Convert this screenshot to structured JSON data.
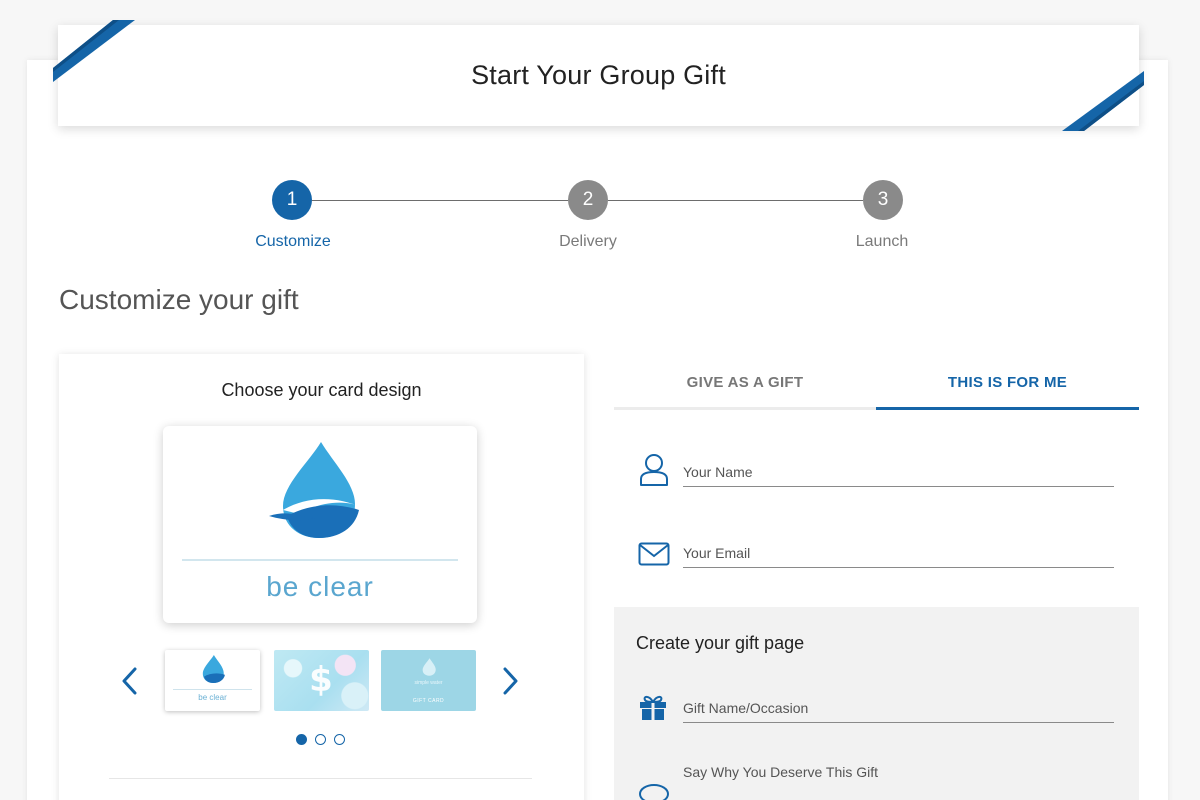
{
  "header": {
    "title": "Start Your Group Gift"
  },
  "steps": [
    {
      "number": "1",
      "label": "Customize",
      "state": "active"
    },
    {
      "number": "2",
      "label": "Delivery",
      "state": "inactive"
    },
    {
      "number": "3",
      "label": "Launch",
      "state": "inactive"
    }
  ],
  "section": {
    "title": "Customize your gift"
  },
  "card_design": {
    "heading": "Choose your card design",
    "preview_tagline": "be clear",
    "thumbnails": [
      {
        "name": "be-clear",
        "text": "be clear"
      },
      {
        "name": "dollar-bubbles",
        "text": "$"
      },
      {
        "name": "gift-card",
        "small_text": "simple water",
        "label": "GIFT CARD"
      }
    ],
    "pagination": {
      "pages": 3,
      "current": 1
    }
  },
  "tabs": [
    {
      "label": "GIVE AS A GIFT",
      "selected": false
    },
    {
      "label": "THIS IS FOR ME",
      "selected": true
    }
  ],
  "form": {
    "name_placeholder": "Your Name",
    "email_placeholder": "Your Email"
  },
  "gift_page": {
    "title": "Create your gift page",
    "occasion_placeholder": "Gift Name/Occasion",
    "reason_placeholder": "Say Why You Deserve This Gift"
  },
  "colors": {
    "accent": "#1565a8",
    "inactive_step": "#8a8a8a",
    "drop_light": "#3aa8de",
    "drop_dark": "#1a6fb8"
  }
}
